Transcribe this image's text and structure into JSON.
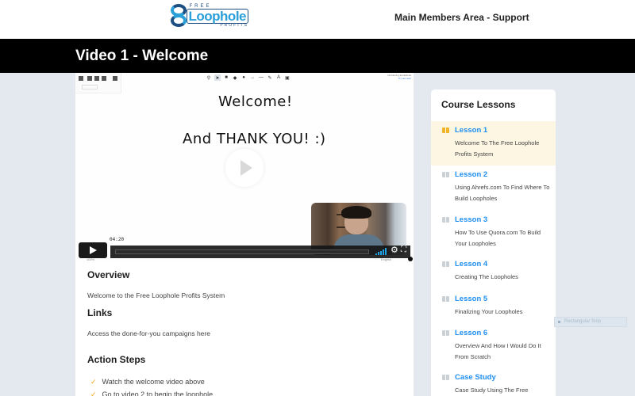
{
  "header": {
    "logo": {
      "top": "FREE",
      "main": "Loophole",
      "bottom": "PROFITS"
    },
    "nav_link": "Main Members Area - Support"
  },
  "page": {
    "title": "Video 1 - Welcome"
  },
  "video": {
    "whiteboard_lines": [
      "Welcome!",
      "And THANK YOU! :)"
    ],
    "timestamp": "04:20",
    "zoom_label": "100%",
    "language": "English",
    "status_line1": "Introducing Excalidraw",
    "status_line2": "Try out now!",
    "toolbar_left_icons": [
      "menu-icon",
      "folder-icon",
      "export-icon",
      "image-icon",
      "users-icon"
    ],
    "toolbar_top_icons": [
      "lock-icon",
      "pointer-icon",
      "rectangle-icon",
      "diamond-icon",
      "circle-icon",
      "arrow-icon",
      "line-icon",
      "pencil-icon",
      "text-icon",
      "image-icon"
    ],
    "volume_bars": 5
  },
  "content": {
    "overview_heading": "Overview",
    "overview_text": "Welcome to the Free Loophole Profits System",
    "links_heading": "Links",
    "links_text": "Access the done-for-you campaigns here",
    "action_heading": "Action Steps",
    "action_steps": [
      "Watch the welcome video above",
      "Go to video 2 to begin the loophole"
    ]
  },
  "sidebar": {
    "title": "Course Lessons",
    "lessons": [
      {
        "title": "Lesson 1",
        "desc": "Welcome To The Free Loophole Profits System",
        "active": true
      },
      {
        "title": "Lesson 2",
        "desc": "Using Ahrefs.com To Find Where To Build Loopholes",
        "active": false
      },
      {
        "title": "Lesson 3",
        "desc": "How To Use Quora.com To Build Your Loopholes",
        "active": false
      },
      {
        "title": "Lesson 4",
        "desc": "Creating The Loopholes",
        "active": false
      },
      {
        "title": "Lesson 5",
        "desc": "Finalizing Your Loopholes",
        "active": false
      },
      {
        "title": "Lesson 6",
        "desc": "Overview And How I Would Do It From Scratch",
        "active": false
      },
      {
        "title": "Case Study",
        "desc": "Case Study Using The Free",
        "active": false
      }
    ],
    "accent_color": "#1f8ef1",
    "active_bg": "#fdf6e3"
  },
  "overlay": {
    "snip_label": "Rectangular Snip"
  }
}
